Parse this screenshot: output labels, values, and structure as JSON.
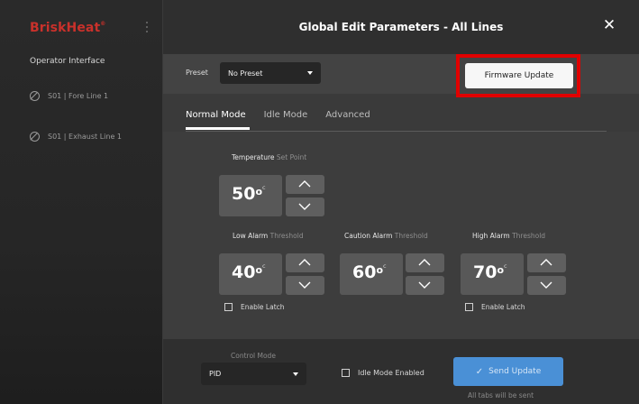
{
  "sidebar": {
    "brand": "BriskHeat",
    "brand_mark": "®",
    "title": "Operator Interface",
    "items": [
      {
        "label": "S01 | Fore Line 1"
      },
      {
        "label": "S01 | Exhaust Line 1"
      }
    ]
  },
  "header": {
    "title": "Global Edit Parameters - All Lines",
    "close_label": "✕"
  },
  "preset": {
    "label": "Preset",
    "selected": "No Preset"
  },
  "firmware_button": "Firmware Update",
  "tabs": [
    {
      "label": "Normal Mode",
      "active": true
    },
    {
      "label": "Idle Mode",
      "active": false
    },
    {
      "label": "Advanced",
      "active": false
    }
  ],
  "setpoint": {
    "label": "Temperature",
    "label_dim": "Set Point",
    "value": "50",
    "deg": "o",
    "unit": "c"
  },
  "alarms": [
    {
      "label": "Low Alarm",
      "label_dim": "Threshold",
      "value": "40",
      "deg": "o",
      "unit": "c",
      "latch": "Enable Latch"
    },
    {
      "label": "Caution Alarm",
      "label_dim": "Threshold",
      "value": "60",
      "deg": "o",
      "unit": "c",
      "latch": ""
    },
    {
      "label": "High Alarm",
      "label_dim": "Threshold",
      "value": "70",
      "deg": "o",
      "unit": "c",
      "latch": "Enable Latch"
    }
  ],
  "footer": {
    "control_mode_label": "Control Mode",
    "control_mode_value": "PID",
    "idle_mode_label": "Idle Mode Enabled",
    "send_label": "Send Update",
    "send_note": "All tabs will be sent"
  },
  "colors": {
    "brand": "#c9312b",
    "accent": "#4a90d6",
    "highlight": "#e00000"
  }
}
